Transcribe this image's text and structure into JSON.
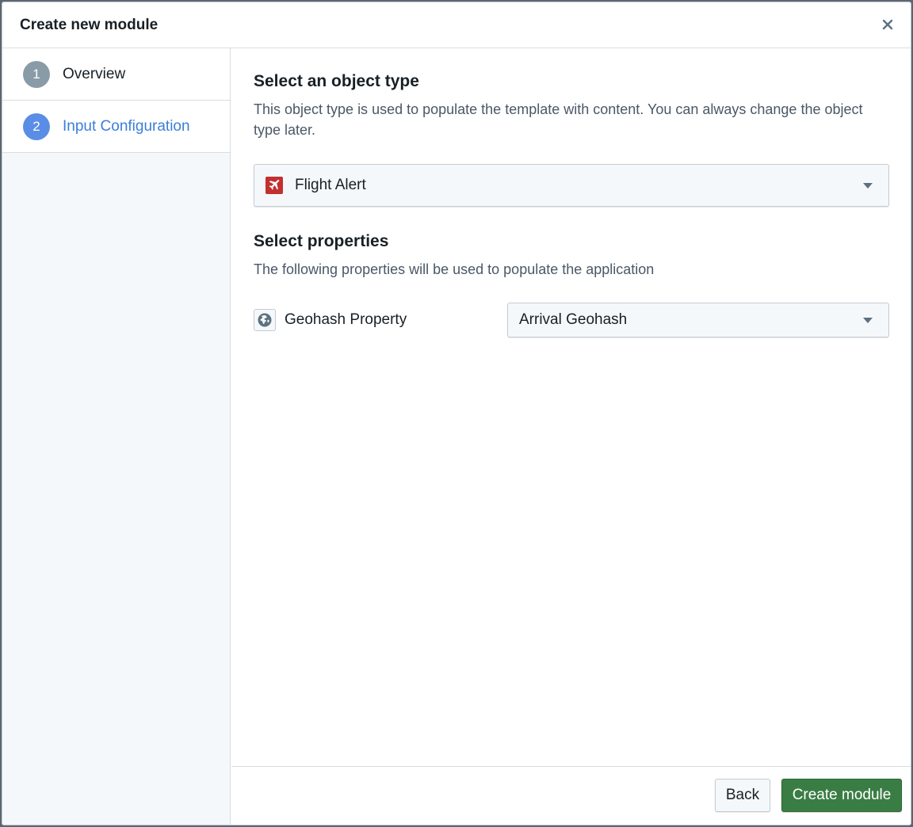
{
  "dialog": {
    "title": "Create new module"
  },
  "steps": [
    {
      "number": "1",
      "label": "Overview",
      "state": "done"
    },
    {
      "number": "2",
      "label": "Input Configuration",
      "state": "active"
    }
  ],
  "object_type": {
    "title": "Select an object type",
    "description": "This object type is used to populate the template with content. You can always change the object type later.",
    "selected": "Flight Alert",
    "icon": "airplane-icon",
    "icon_color": "#c23030"
  },
  "properties": {
    "title": "Select properties",
    "description": "The following properties will be used to populate the application",
    "rows": [
      {
        "icon": "globe-icon",
        "label": "Geohash Property",
        "selected": "Arrival Geohash"
      }
    ]
  },
  "footer": {
    "back_label": "Back",
    "create_label": "Create module",
    "create_color": "#3a7d44"
  }
}
